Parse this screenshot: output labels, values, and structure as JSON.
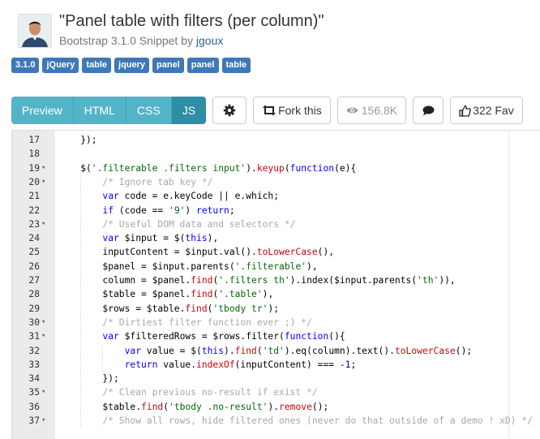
{
  "header": {
    "title": "\"Panel table with filters (per column)\"",
    "subtitle_prefix": "Bootstrap 3.1.0 Snippet by ",
    "author": "jgoux"
  },
  "tags": [
    "3.1.0",
    "jQuery",
    "table",
    "jquery",
    "panel",
    "panel",
    "table"
  ],
  "tabs": {
    "preview": "Preview",
    "html": "HTML",
    "css": "CSS",
    "js": "JS",
    "active": "JS"
  },
  "actions": {
    "fork_label": "Fork this",
    "views": "156.8K",
    "fav": "322 Fav"
  },
  "icons": {
    "settings": "gear-icon",
    "fork": "retweet-icon",
    "views": "eye-icon",
    "comment": "comment-icon",
    "fav": "thumbs-up-icon"
  },
  "colors": {
    "tag": "#3e78b6",
    "tab": "#54b4c7",
    "tab_active": "#2d8ea6",
    "gutter": "#ebebeb",
    "keyword": "#0000ff",
    "function": "#c5060b",
    "string": "#036a07",
    "comment": "#a8a8a8"
  },
  "code": [
    {
      "n": "17",
      "fold": false,
      "indent": 1,
      "segs": [
        [
          "",
          "});"
        ]
      ]
    },
    {
      "n": "18",
      "fold": false,
      "indent": 0,
      "segs": []
    },
    {
      "n": "19",
      "fold": true,
      "indent": 1,
      "segs": [
        [
          "",
          "$("
        ],
        [
          "s",
          "'.filterable .filters input'"
        ],
        [
          "",
          ")."
        ],
        [
          "f",
          "keyup"
        ],
        [
          "",
          "("
        ],
        [
          "k",
          "function"
        ],
        [
          "",
          "(e){"
        ]
      ]
    },
    {
      "n": "20",
      "fold": true,
      "indent": 2,
      "segs": [
        [
          "c",
          "/* Ignore tab key */"
        ]
      ]
    },
    {
      "n": "21",
      "fold": false,
      "indent": 2,
      "segs": [
        [
          "k",
          "var"
        ],
        [
          "",
          " code = e.keyCode || e.which;"
        ]
      ]
    },
    {
      "n": "22",
      "fold": false,
      "indent": 2,
      "segs": [
        [
          "k",
          "if"
        ],
        [
          "",
          " (code == "
        ],
        [
          "s",
          "'9'"
        ],
        [
          "",
          ") "
        ],
        [
          "k",
          "return"
        ],
        [
          "",
          ";"
        ]
      ]
    },
    {
      "n": "23",
      "fold": true,
      "indent": 2,
      "segs": [
        [
          "c",
          "/* Useful DOM data and selectors */"
        ]
      ]
    },
    {
      "n": "24",
      "fold": false,
      "indent": 2,
      "segs": [
        [
          "k",
          "var"
        ],
        [
          "",
          " $input = $("
        ],
        [
          "k",
          "this"
        ],
        [
          "",
          "),"
        ]
      ]
    },
    {
      "n": "25",
      "fold": false,
      "indent": 2,
      "segs": [
        [
          "",
          "inputContent = $input.val()."
        ],
        [
          "f",
          "toLowerCase"
        ],
        [
          "",
          "(),"
        ]
      ]
    },
    {
      "n": "26",
      "fold": false,
      "indent": 2,
      "segs": [
        [
          "",
          "$panel = $input.parents("
        ],
        [
          "s",
          "'.filterable'"
        ],
        [
          "",
          "),"
        ]
      ]
    },
    {
      "n": "27",
      "fold": false,
      "indent": 2,
      "segs": [
        [
          "",
          "column = $panel."
        ],
        [
          "f",
          "find"
        ],
        [
          "",
          "("
        ],
        [
          "s",
          "'.filters th'"
        ],
        [
          "",
          ").index($input.parents("
        ],
        [
          "s",
          "'th'"
        ],
        [
          "",
          ")),"
        ]
      ]
    },
    {
      "n": "28",
      "fold": false,
      "indent": 2,
      "segs": [
        [
          "",
          "$table = $panel."
        ],
        [
          "f",
          "find"
        ],
        [
          "",
          "("
        ],
        [
          "s",
          "'.table'"
        ],
        [
          "",
          "),"
        ]
      ]
    },
    {
      "n": "29",
      "fold": false,
      "indent": 2,
      "segs": [
        [
          "",
          "$rows = $table."
        ],
        [
          "f",
          "find"
        ],
        [
          "",
          "("
        ],
        [
          "s",
          "'tbody tr'"
        ],
        [
          "",
          ");"
        ]
      ]
    },
    {
      "n": "30",
      "fold": true,
      "indent": 2,
      "segs": [
        [
          "c",
          "/* Dirtiest filter function ever ;) */"
        ]
      ]
    },
    {
      "n": "31",
      "fold": true,
      "indent": 2,
      "segs": [
        [
          "k",
          "var"
        ],
        [
          "",
          " $filteredRows = $rows.filter("
        ],
        [
          "k",
          "function"
        ],
        [
          "",
          "(){"
        ]
      ]
    },
    {
      "n": "32",
      "fold": false,
      "indent": 3,
      "segs": [
        [
          "k",
          "var"
        ],
        [
          "",
          " value = $("
        ],
        [
          "k",
          "this"
        ],
        [
          "",
          ")."
        ],
        [
          "f",
          "find"
        ],
        [
          "",
          "("
        ],
        [
          "s",
          "'td'"
        ],
        [
          "",
          ").eq(column).text()."
        ],
        [
          "f",
          "toLowerCase"
        ],
        [
          "",
          "();"
        ]
      ]
    },
    {
      "n": "33",
      "fold": false,
      "indent": 3,
      "segs": [
        [
          "k",
          "return"
        ],
        [
          "",
          " value."
        ],
        [
          "f",
          "indexOf"
        ],
        [
          "",
          "(inputContent) === -"
        ],
        [
          "n",
          "1"
        ],
        [
          "",
          ";"
        ]
      ]
    },
    {
      "n": "34",
      "fold": false,
      "indent": 2,
      "segs": [
        [
          "",
          "});"
        ]
      ]
    },
    {
      "n": "35",
      "fold": true,
      "indent": 2,
      "segs": [
        [
          "c",
          "/* Clean previous no-result if exist */"
        ]
      ]
    },
    {
      "n": "36",
      "fold": false,
      "indent": 2,
      "segs": [
        [
          "",
          "$table."
        ],
        [
          "f",
          "find"
        ],
        [
          "",
          "("
        ],
        [
          "s",
          "'tbody .no-result'"
        ],
        [
          "",
          ")."
        ],
        [
          "f",
          "remove"
        ],
        [
          "",
          "();"
        ]
      ]
    },
    {
      "n": "37",
      "fold": true,
      "indent": 2,
      "segs": [
        [
          "c",
          "/* Show all rows, hide filtered ones (never do that outside of a demo ! xD) */"
        ]
      ]
    }
  ]
}
